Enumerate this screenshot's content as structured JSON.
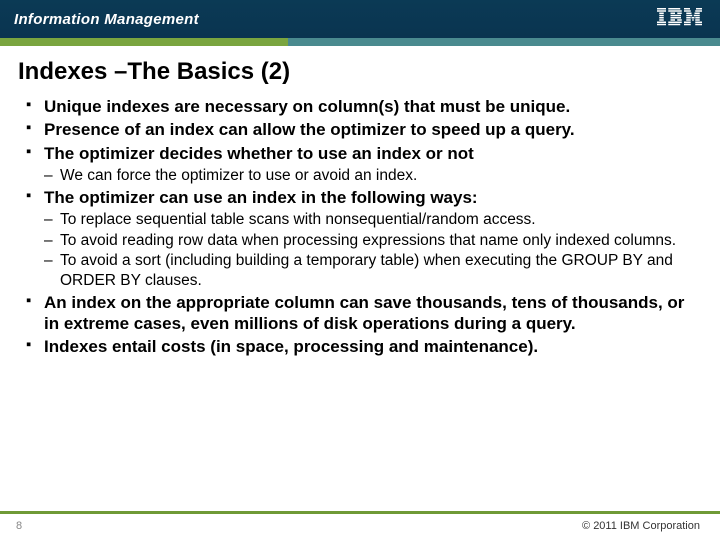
{
  "header": {
    "brand": "Information Management",
    "logo_name": "ibm-logo"
  },
  "title": "Indexes –The Basics (2)",
  "bullets": [
    {
      "text": "Unique indexes are necessary on column(s) that must be unique."
    },
    {
      "text": "Presence of an index can allow the optimizer to speed up a query."
    },
    {
      "text": "The optimizer decides whether to use an index or not",
      "sub": [
        "We can force the optimizer to use or avoid an index."
      ]
    },
    {
      "text": "The optimizer can use an index in the following ways:",
      "sub": [
        "To replace sequential table scans with nonsequential/random access.",
        "To avoid reading row data when processing expressions that name only indexed columns.",
        "To avoid a sort (including building a temporary table) when executing the GROUP BY and ORDER BY clauses."
      ]
    },
    {
      "text": "An index on the appropriate column can save thousands, tens of thousands, or in extreme cases, even millions of disk operations during a query."
    },
    {
      "text": "Indexes entail costs (in space, processing and maintenance)."
    }
  ],
  "footer": {
    "page": "8",
    "copyright": "© 2011 IBM Corporation"
  }
}
